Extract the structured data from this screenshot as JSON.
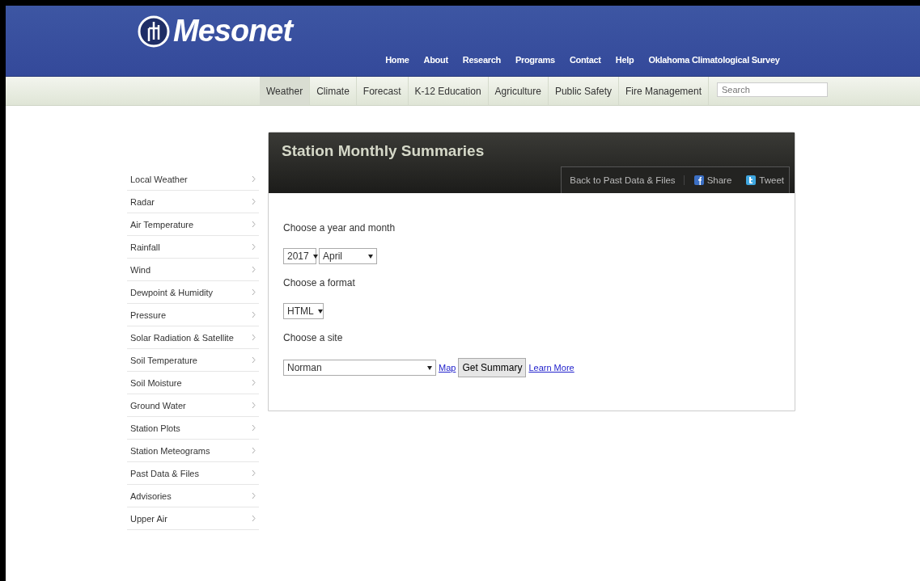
{
  "header": {
    "logo_text": "Mesonet",
    "links": [
      "Home",
      "About",
      "Research",
      "Programs",
      "Contact",
      "Help",
      "Oklahoma Climatological Survey"
    ]
  },
  "nav": {
    "tabs": [
      {
        "label": "Weather",
        "selected": true
      },
      {
        "label": "Climate",
        "selected": false
      },
      {
        "label": "Forecast",
        "selected": false
      },
      {
        "label": "K-12 Education",
        "selected": false
      },
      {
        "label": "Agriculture",
        "selected": false
      },
      {
        "label": "Public Safety",
        "selected": false
      },
      {
        "label": "Fire Management",
        "selected": false
      }
    ],
    "search": {
      "placeholder": "Search"
    }
  },
  "sidebar": {
    "items": [
      "Local Weather",
      "Radar",
      "Air Temperature",
      "Rainfall",
      "Wind",
      "Dewpoint & Humidity",
      "Pressure",
      "Solar Radiation & Satellite",
      "Soil Temperature",
      "Soil Moisture",
      "Ground Water",
      "Station Plots",
      "Station Meteograms",
      "Past Data & Files",
      "Advisories",
      "Upper Air"
    ]
  },
  "panel": {
    "title": "Station Monthly Summaries",
    "back_link": "Back to Past Data & Files",
    "share": "Share",
    "tweet": "Tweet"
  },
  "form": {
    "date_label": "Choose a year and month",
    "year": "2017",
    "month": "April",
    "format_label": "Choose a format",
    "format": "HTML",
    "site_label": "Choose a site",
    "site": "Norman",
    "map_link": "Map",
    "submit": "Get Summary",
    "learn_more": "Learn More"
  }
}
